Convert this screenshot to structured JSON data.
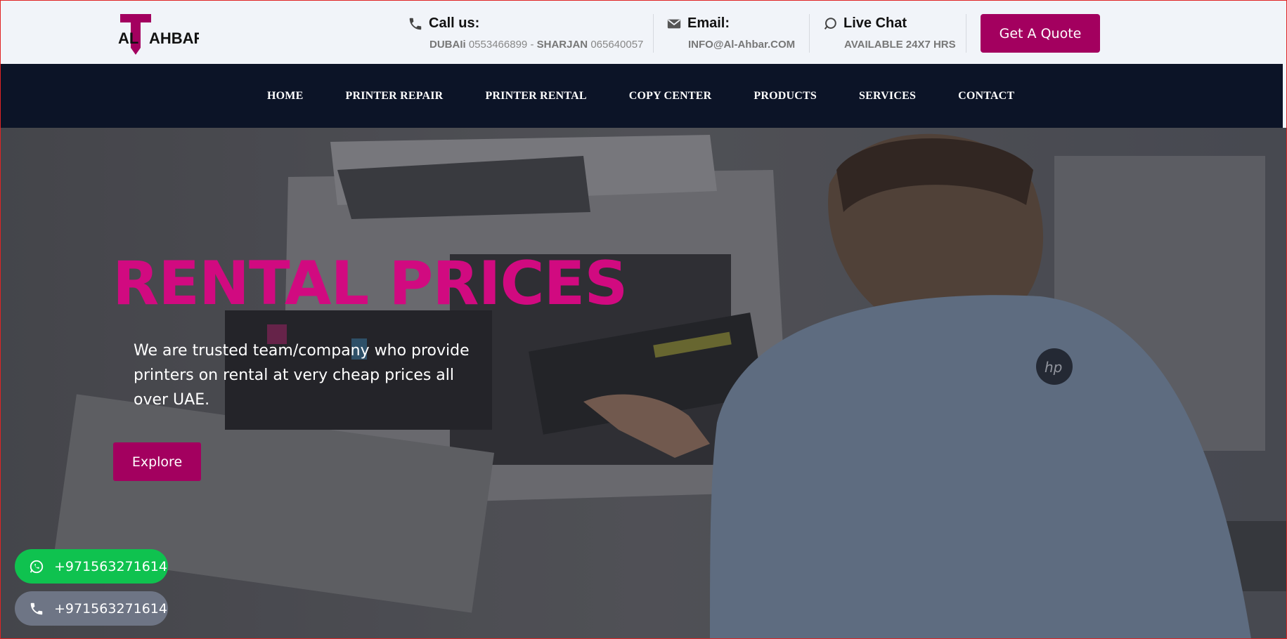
{
  "header": {
    "logo_text": "ALTAHBAR",
    "call": {
      "title": "Call us:",
      "city1": "DUBAIi",
      "phone1": "0553466899",
      "sep": "-",
      "city2": "SHARJAN",
      "phone2": "065640057"
    },
    "email": {
      "title": "Email:",
      "value": "INFO@Al-Ahbar.COM"
    },
    "chat": {
      "title": "Live Chat",
      "value": "AVAILABLE 24X7 HRS"
    },
    "quote_label": "Get A Quote"
  },
  "nav": {
    "items": [
      "HOME",
      "PRINTER REPAIR",
      "PRINTER RENTAL",
      "COPY CENTER",
      "PRODUCTS",
      "SERVICES",
      "CONTACT"
    ]
  },
  "hero": {
    "title": "RENTAL PRICES",
    "text": "We are trusted team/company who provide printers on rental at very cheap prices all over UAE.",
    "button": "Explore",
    "brand_mark": "hp"
  },
  "floating": {
    "whatsapp": "+971563271614",
    "phone": "+971563271614"
  },
  "colors": {
    "accent": "#a3005f",
    "title_pink": "#d10a80",
    "nav_bg": "#0c1427",
    "whatsapp_green": "#0fc24f",
    "phone_gray": "#6e7585"
  },
  "icons": [
    "phone-icon",
    "envelope-icon",
    "chat-icon",
    "whatsapp-icon"
  ]
}
